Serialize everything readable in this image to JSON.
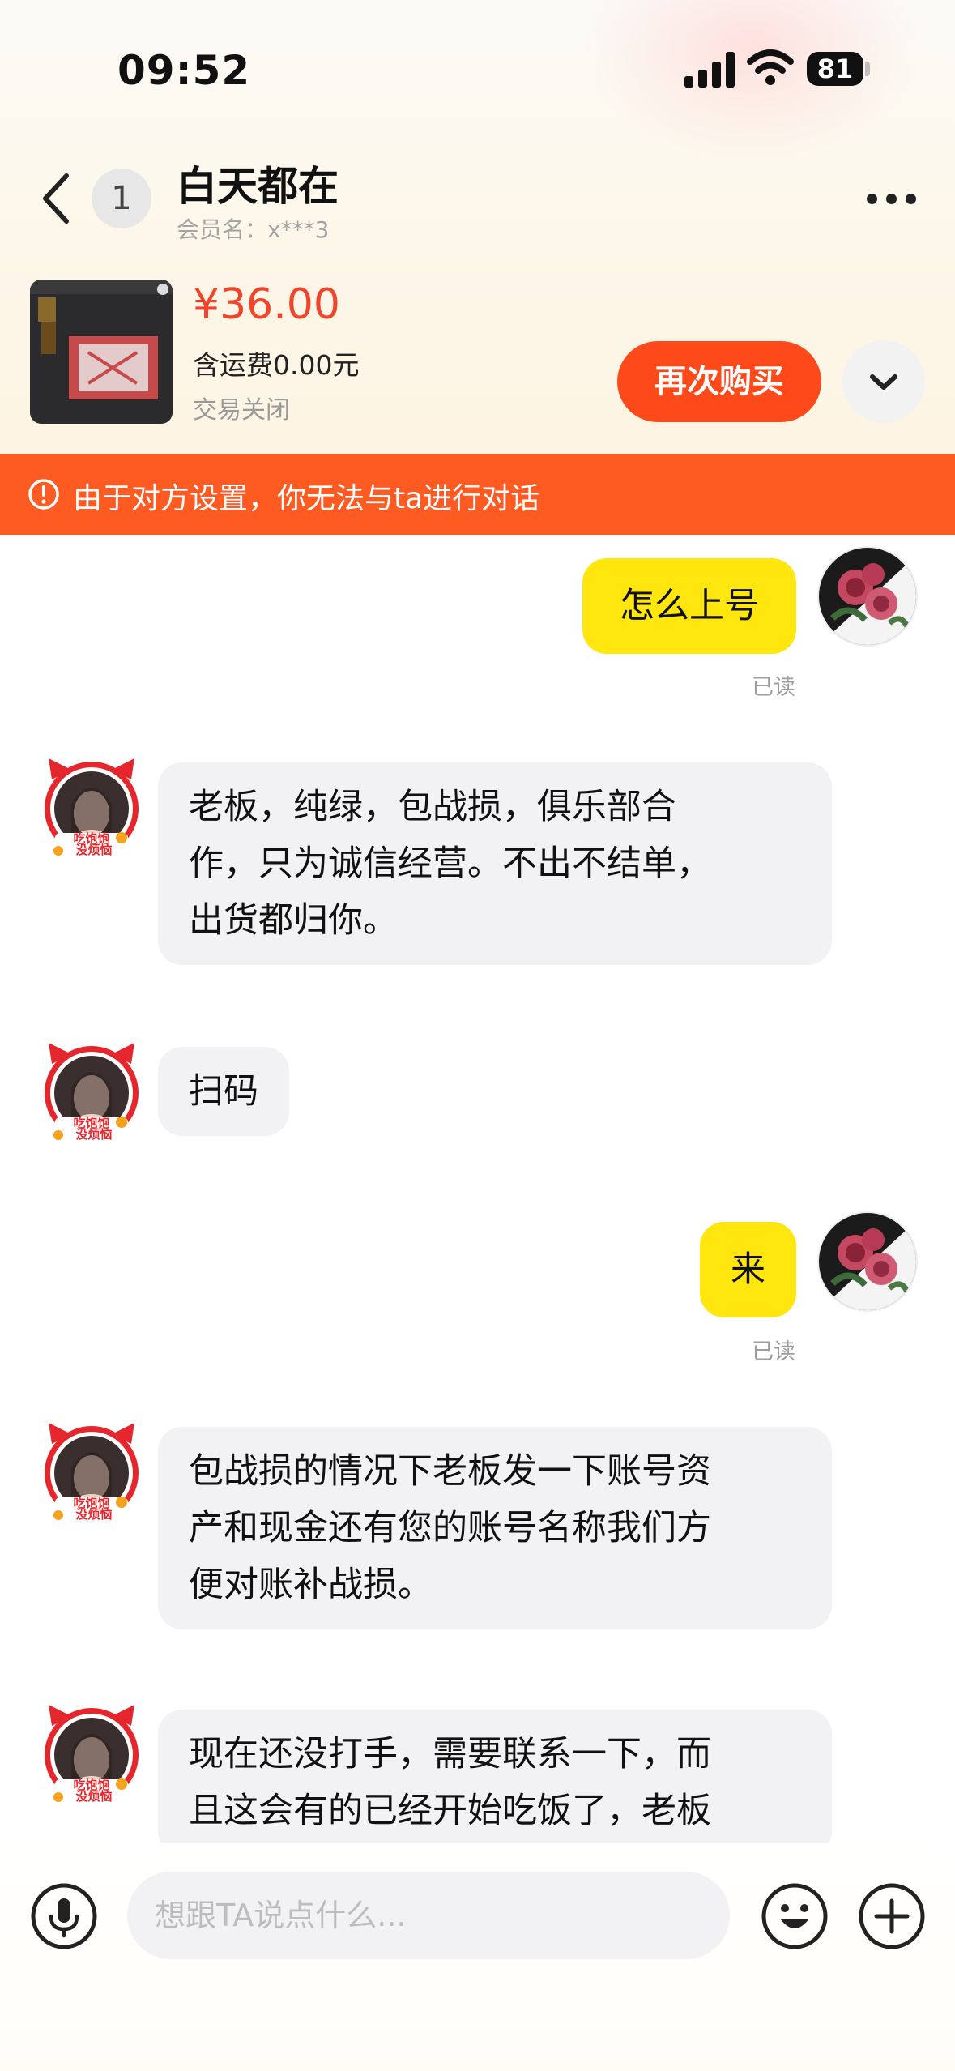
{
  "status_bar": {
    "time": "09:52",
    "battery": "81"
  },
  "header": {
    "unread_count": "1",
    "title": "白天都在",
    "member_name": "会员名：x***3"
  },
  "product": {
    "price": "¥36.00",
    "shipping": "含运费0.00元",
    "order_status": "交易关闭",
    "rebuy_label": "再次购买"
  },
  "banner": {
    "text": "由于对方设置，你无法与ta进行对话"
  },
  "messages": [
    {
      "side": "me",
      "text": "怎么上号",
      "read": "已读"
    },
    {
      "side": "them",
      "lines": [
        "老板，纯绿，包战损，俱乐部合",
        "作，只为诚信经营。不出不结单，",
        "出货都归你。"
      ]
    },
    {
      "side": "them",
      "lines": [
        "扫码"
      ]
    },
    {
      "side": "me",
      "text": "来",
      "read": "已读"
    },
    {
      "side": "them",
      "lines": [
        "包战损的情况下老板发一下账号资",
        "产和现金还有您的账号名称我们方",
        "便对账补战损。"
      ]
    },
    {
      "side": "them",
      "lines": [
        "现在还没打手，需要联系一下，而",
        "且这会有的已经开始吃饭了，老板"
      ]
    }
  ],
  "avatar_badge": {
    "line1": "吃饱饱",
    "line2": "没烦恼"
  },
  "input_bar": {
    "placeholder": "想跟TA说点什么..."
  },
  "colors": {
    "accent": "#fe4a1b",
    "banner": "#fe5b23",
    "price": "#f0452b",
    "my_bubble": "#ffe60f",
    "their_bubble": "#f2f2f4"
  },
  "icons": {
    "back": "chevron-left-icon",
    "more": "more-dots-icon",
    "expand": "chevron-down-icon",
    "warning": "alert-circle-icon",
    "mic": "microphone-icon",
    "emoji": "emoji-smile-icon",
    "plus": "plus-circle-icon"
  }
}
